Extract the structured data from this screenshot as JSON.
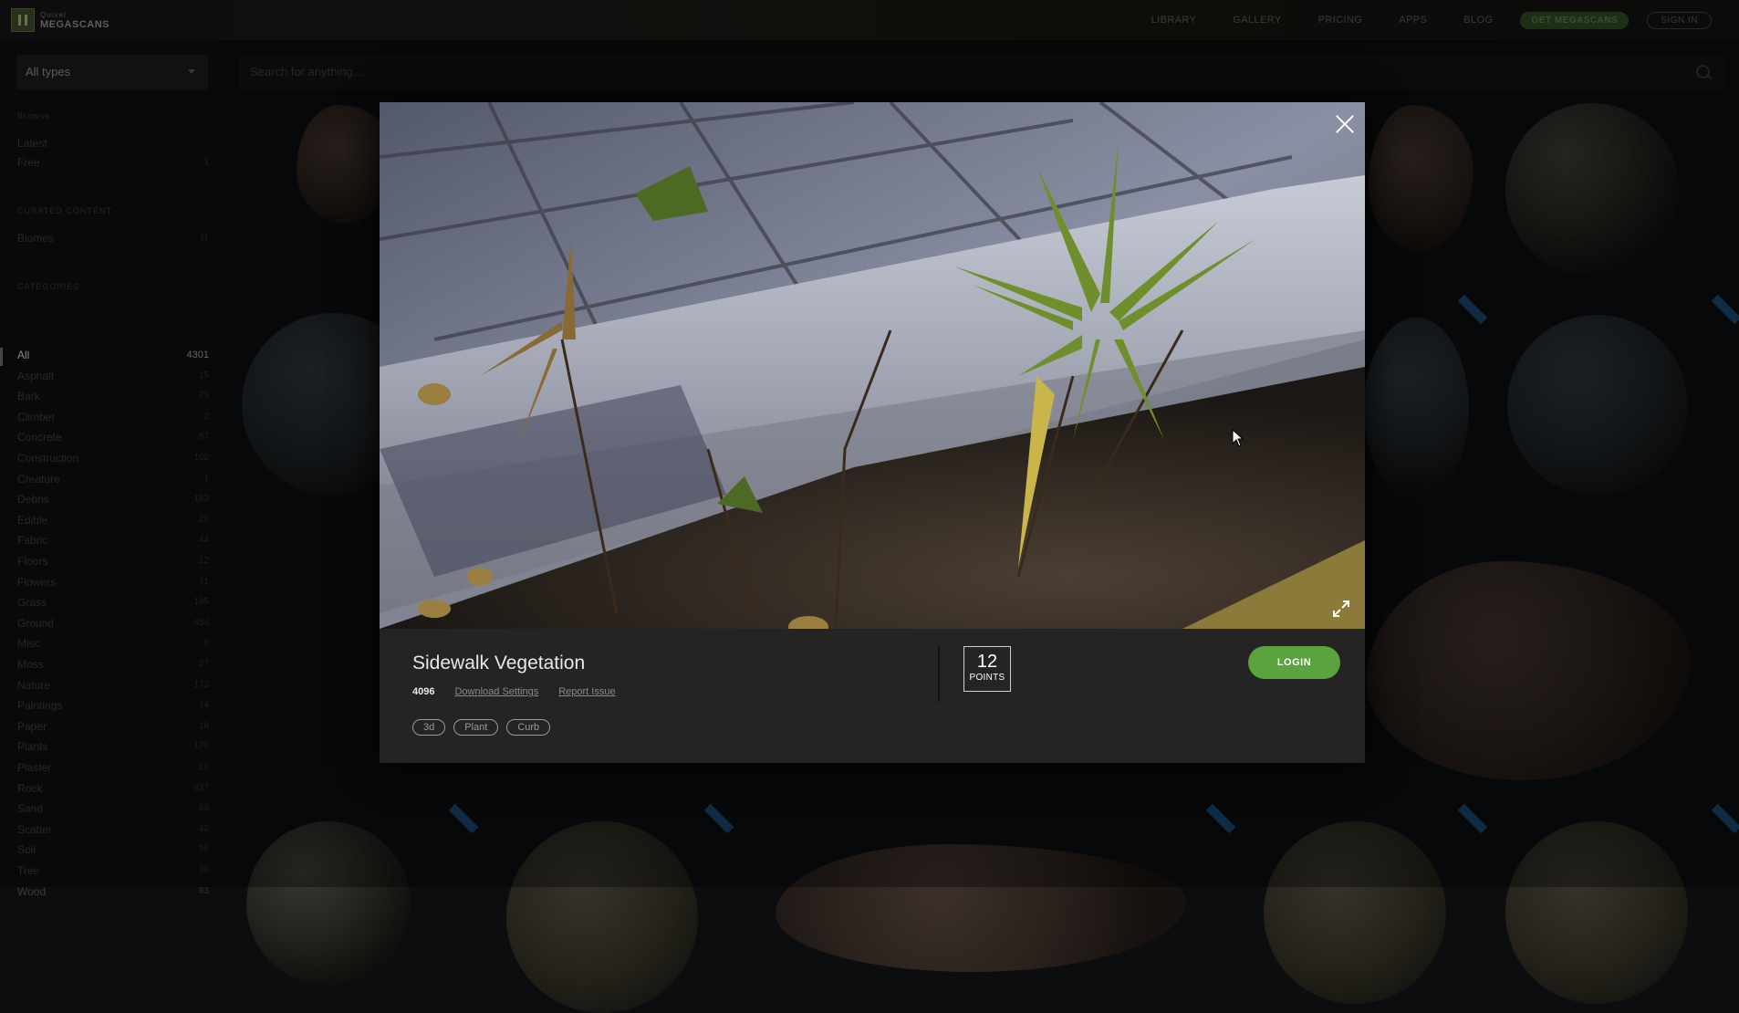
{
  "header": {
    "logo_small": "Quixel",
    "logo_big": "MEGASCANS",
    "nav": [
      "LIBRARY",
      "GALLERY",
      "PRICING",
      "APPS",
      "BLOG"
    ],
    "get_button": "GET MEGASCANS",
    "sign_in": "SIGN IN"
  },
  "sidebar": {
    "type_select": "All types",
    "sections": {
      "browse": "Browse",
      "curated": "CURATED CONTENT",
      "categories": "CATEGORIES"
    },
    "browse_items": [
      {
        "label": "Latest",
        "count": ""
      },
      {
        "label": "Free",
        "count": "1"
      }
    ],
    "curated_items": [
      {
        "label": "Biomes",
        "count": "11"
      }
    ],
    "categories": [
      {
        "label": "All",
        "count": "4301"
      },
      {
        "label": "Asphalt",
        "count": "15"
      },
      {
        "label": "Bark",
        "count": "73"
      },
      {
        "label": "Climber",
        "count": "2"
      },
      {
        "label": "Concrete",
        "count": "87"
      },
      {
        "label": "Construction",
        "count": "102"
      },
      {
        "label": "Creature",
        "count": "1"
      },
      {
        "label": "Debris",
        "count": "183"
      },
      {
        "label": "Edible",
        "count": "25"
      },
      {
        "label": "Fabric",
        "count": "44"
      },
      {
        "label": "Floors",
        "count": "12"
      },
      {
        "label": "Flowers",
        "count": "71"
      },
      {
        "label": "Grass",
        "count": "195"
      },
      {
        "label": "Ground",
        "count": "454"
      },
      {
        "label": "Misc",
        "count": "8"
      },
      {
        "label": "Moss",
        "count": "27"
      },
      {
        "label": "Nature",
        "count": "173"
      },
      {
        "label": "Paintings",
        "count": "14"
      },
      {
        "label": "Paper",
        "count": "18"
      },
      {
        "label": "Plants",
        "count": "170"
      },
      {
        "label": "Plaster",
        "count": "19"
      },
      {
        "label": "Rock",
        "count": "637"
      },
      {
        "label": "Sand",
        "count": "89"
      },
      {
        "label": "Scatter",
        "count": "42"
      },
      {
        "label": "Soil",
        "count": "96"
      },
      {
        "label": "Tree",
        "count": "38"
      },
      {
        "label": "Wood",
        "count": "83"
      }
    ]
  },
  "search": {
    "placeholder": "Search for anything..."
  },
  "modal": {
    "title": "Sidewalk Vegetation",
    "resolution": "4096",
    "download_settings": "Download Settings",
    "report_issue": "Report Issue",
    "points_value": "12",
    "points_label": "POINTS",
    "login": "LOGIN",
    "tags": [
      "3d",
      "Plant",
      "Curb"
    ]
  }
}
